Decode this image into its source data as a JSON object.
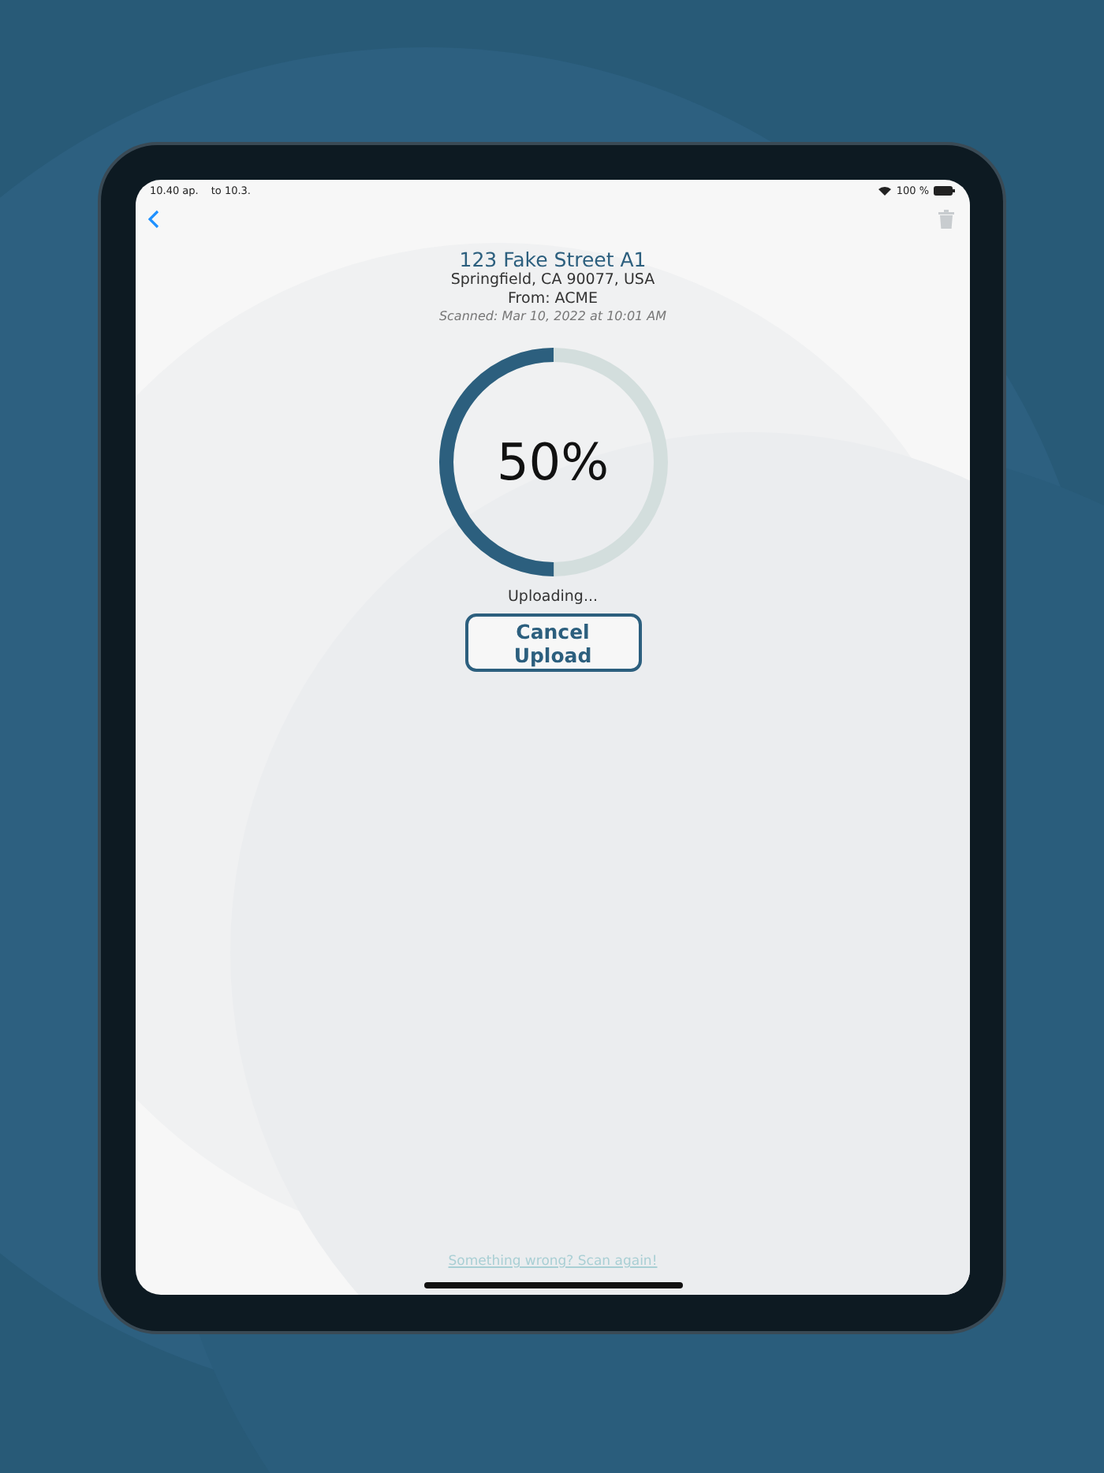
{
  "status_bar": {
    "time": "10.40 ap.",
    "date": "to 10.3.",
    "battery": "100 %"
  },
  "address": {
    "street": "123 Fake Street A1",
    "city": "Springfield, CA 90077, USA",
    "from": "From: ACME",
    "scanned": "Scanned: Mar 10, 2022 at 10:01 AM"
  },
  "progress": {
    "level": 0.5,
    "reading": "50%",
    "status": "Uploading..."
  },
  "cancel_button": "Cancel Upload",
  "rescan_link": "Something wrong? Scan again!"
}
